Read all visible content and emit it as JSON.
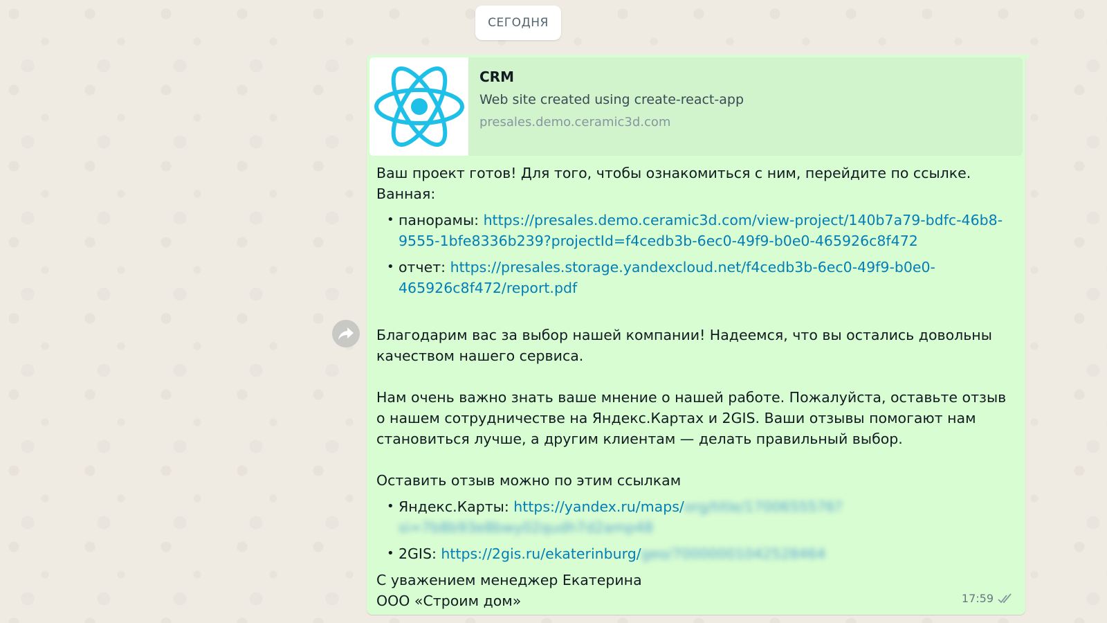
{
  "date_separator": "СЕГОДНЯ",
  "link_preview": {
    "title": "CRM",
    "description": "Web site created using create-react-app",
    "domain": "presales.demo.ceramic3d.com"
  },
  "message": {
    "intro_line1": "Ваш проект готов! Для того, чтобы ознакомиться с ним, перейдите по ссылке.",
    "intro_line2": "Ванная:",
    "project_links": [
      {
        "label": "панорамы: ",
        "url": "https://presales.demo.ceramic3d.com/view-project/140b7a79-bdfc-46b8-9555-1bfe8336b239?projectId=f4cedb3b-6ec0-49f9-b0e0-465926c8f472"
      },
      {
        "label": "отчет: ",
        "url": "https://presales.storage.yandexcloud.net/f4cedb3b-6ec0-49f9-b0e0-465926c8f472/report.pdf"
      }
    ],
    "thanks": "Благодарим вас за выбор нашей компании! Надеемся, что вы остались довольны качеством нашего сервиса.",
    "review_request": "Нам очень важно знать ваше мнение о нашей работе. Пожалуйста, оставьте отзыв о нашем сотрудничестве на Яндекс.Картах и 2GIS. Ваши отзывы помогают нам становиться лучше, а другим клиентам — делать правильный выбор.",
    "review_intro": "Оставить отзыв можно по этим ссылкам",
    "review_links": [
      {
        "label": "Яндекс.Карты: ",
        "url_visible": "https://yandex.ru/maps/",
        "url_blurred": "org/title/1700655576?si=7b8b93e8bwy02qudh7d2amp48"
      },
      {
        "label": "2GIS: ",
        "url_visible": "https://2gis.ru/ekaterinburg/",
        "url_blurred": "geo/70000001042528464"
      }
    ],
    "signature_line1": "С уважением  менеджер Екатерина",
    "signature_line2": "ООО «Строим дом»",
    "time": "17:59",
    "status_icon": "double-check-icon"
  },
  "colors": {
    "bubble": "#d9fdd3",
    "preview": "#d1f4cc",
    "link": "#027eb5",
    "react_logo": "#1ec0e8"
  }
}
